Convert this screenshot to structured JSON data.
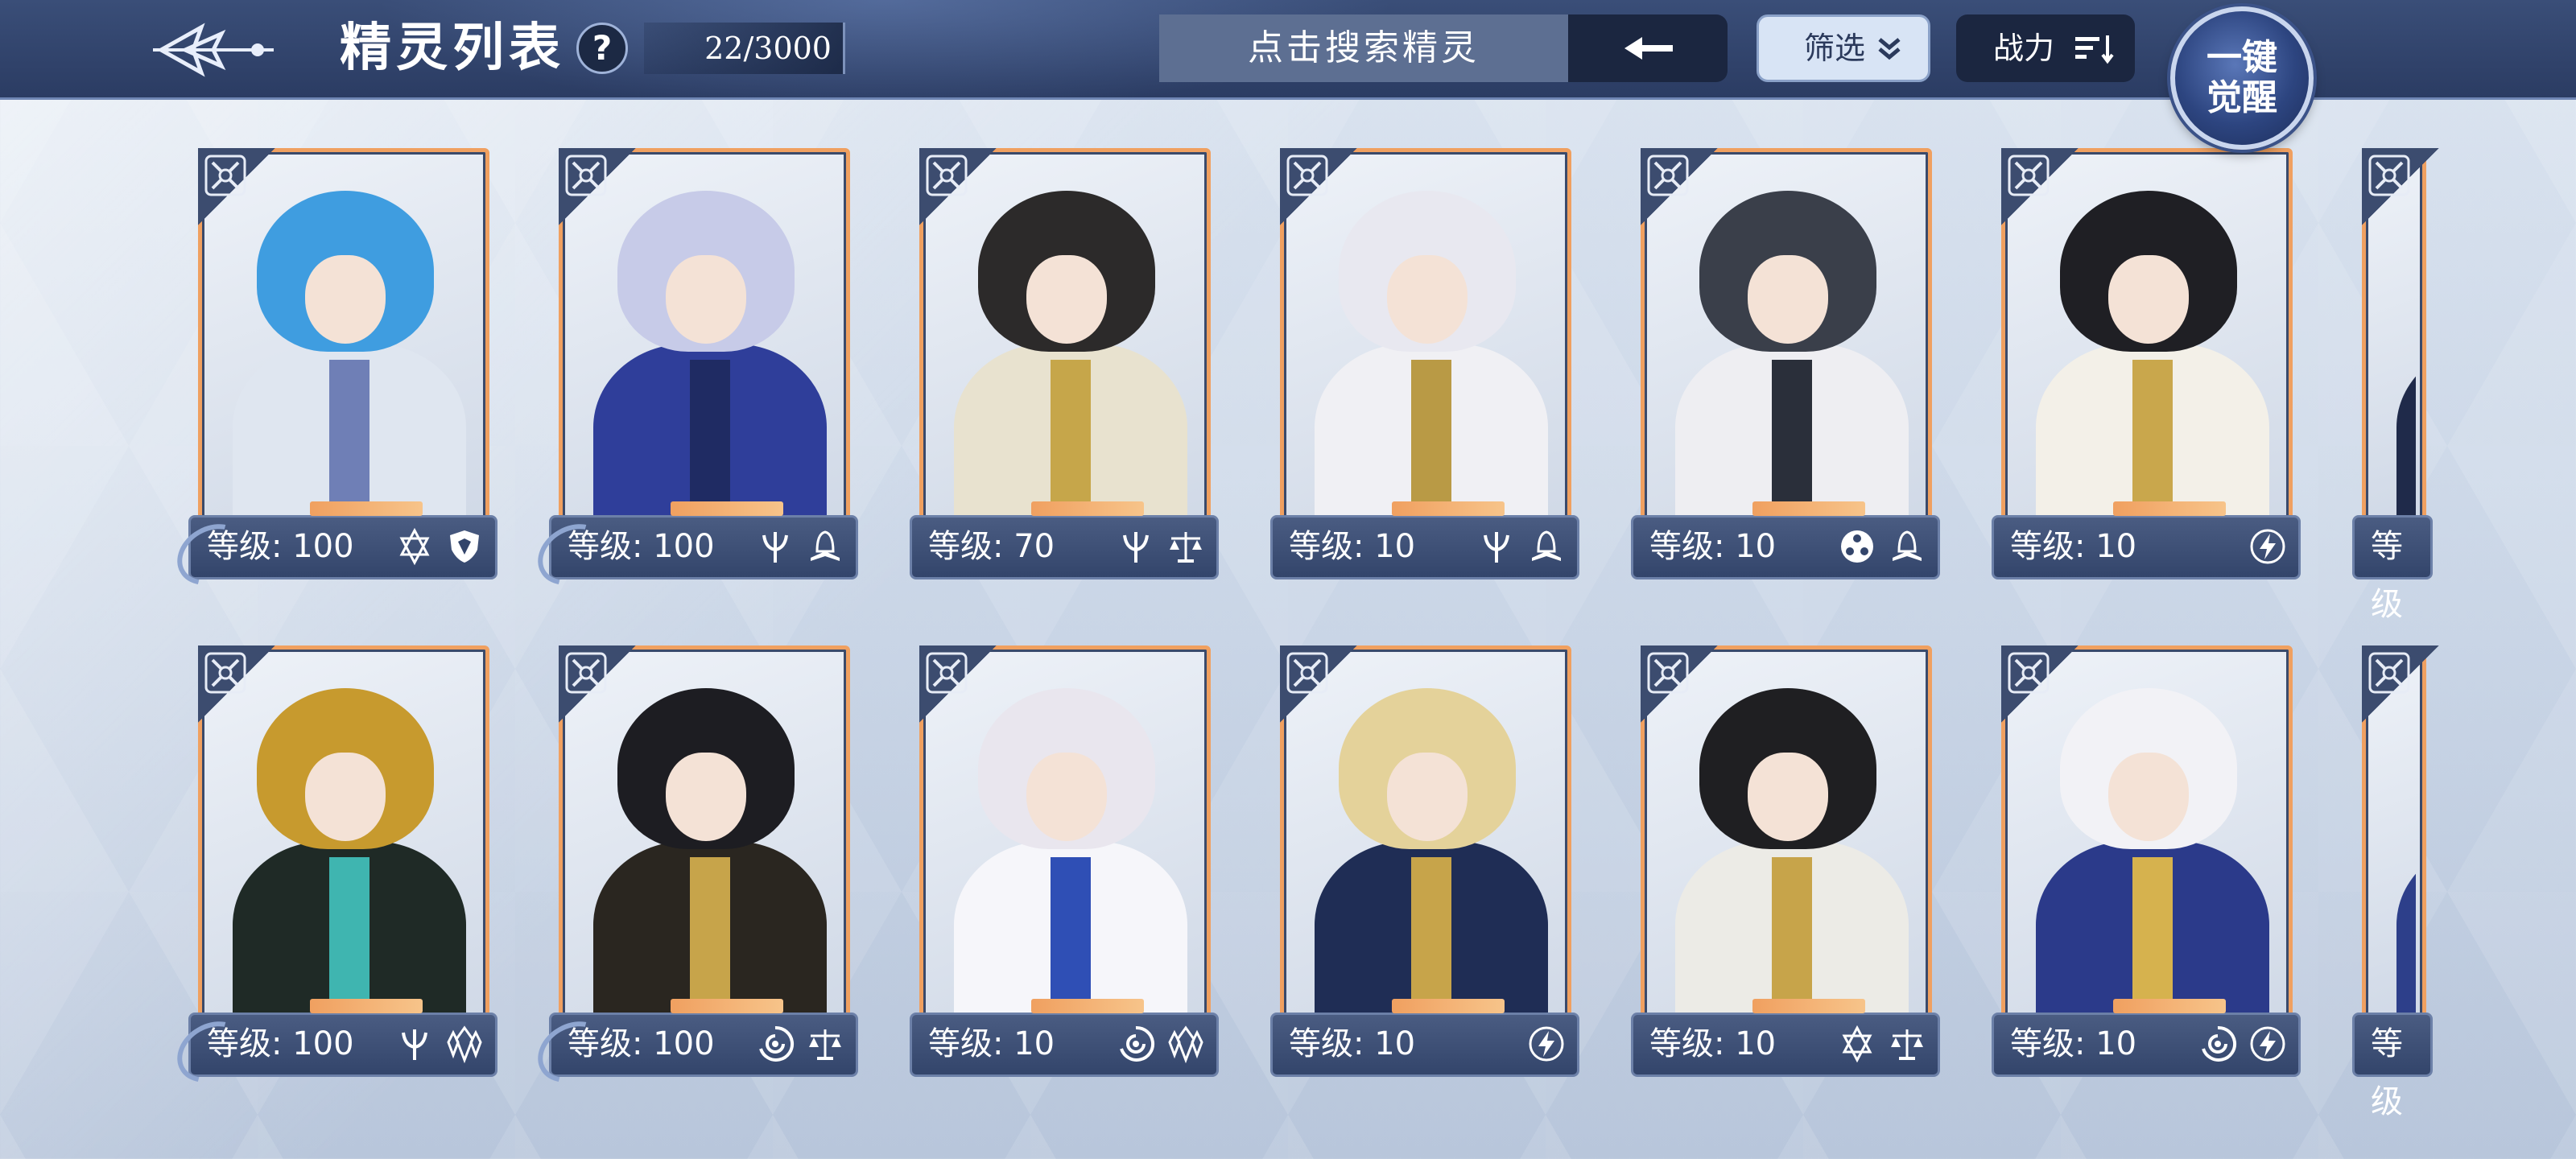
{
  "header": {
    "title": "精灵列表",
    "help_label": "?",
    "count": "22/3000",
    "search_placeholder": "点击搜索精灵",
    "filter_label": "筛选",
    "sort_label": "战力",
    "awaken_line1": "一键",
    "awaken_line2": "觉醒"
  },
  "cards": [
    {
      "level": "等级: 100",
      "icons": [
        "hexagram-icon",
        "shield-icon"
      ],
      "hair": "#3f9de0",
      "body": "#dfe6f0",
      "accent": "#6f7fb6"
    },
    {
      "level": "等级: 100",
      "icons": [
        "trident-icon",
        "tome-icon"
      ],
      "hair": "#c7cbe8",
      "body": "#2f3e9a",
      "accent": "#1f2b63"
    },
    {
      "level": "等级: 70",
      "icons": [
        "trident-icon",
        "scales-icon"
      ],
      "hair": "#2c2a2a",
      "body": "#e8e2cf",
      "accent": "#c6a64a"
    },
    {
      "level": "等级: 10",
      "icons": [
        "trident-icon",
        "tome-icon"
      ],
      "hair": "#e8e8f0",
      "body": "#f0f0f4",
      "accent": "#b99a45"
    },
    {
      "level": "等级: 10",
      "icons": [
        "tomoe-icon",
        "tome-icon"
      ],
      "hair": "#3a3f4a",
      "body": "#eeeef2",
      "accent": "#2a2f3a"
    },
    {
      "level": "等级: 10",
      "icons": [
        "lightning-icon"
      ],
      "hair": "#1f1f24",
      "body": "#f3f0e8",
      "accent": "#c9a74c"
    },
    {
      "level": "等级: 100",
      "icons": [
        "trident-icon",
        "crystal-icon"
      ],
      "hair": "#c79a2e",
      "body": "#1f2a26",
      "accent": "#3fb5b0"
    },
    {
      "level": "等级: 100",
      "icons": [
        "vortex-icon",
        "scales-icon"
      ],
      "hair": "#1d1d22",
      "body": "#2a2620",
      "accent": "#c7a44a"
    },
    {
      "level": "等级: 10",
      "icons": [
        "vortex-icon",
        "crystal-icon"
      ],
      "hair": "#e9e6ee",
      "body": "#f6f6fa",
      "accent": "#2f4fb5"
    },
    {
      "level": "等级: 10",
      "icons": [
        "lightning-icon"
      ],
      "hair": "#e4d29a",
      "body": "#1f2d55",
      "accent": "#c7a44a"
    },
    {
      "level": "等级: 10",
      "icons": [
        "hexagram-icon",
        "scales-icon"
      ],
      "hair": "#1f1f22",
      "body": "#ecebe6",
      "accent": "#c7a44a"
    },
    {
      "level": "等级: 10",
      "icons": [
        "vortex-icon",
        "lightning-icon"
      ],
      "hair": "#f2f2f6",
      "body": "#2b3a8a",
      "accent": "#d6b24e"
    }
  ],
  "partial_cards": [
    {
      "level": "等级",
      "hair": "#b8343a",
      "body": "#1f2a4a",
      "accent": "#d8d8e0"
    },
    {
      "level": "等级",
      "hair": "#c69a3a",
      "body": "#2d3f8a",
      "accent": "#d8b258"
    }
  ]
}
